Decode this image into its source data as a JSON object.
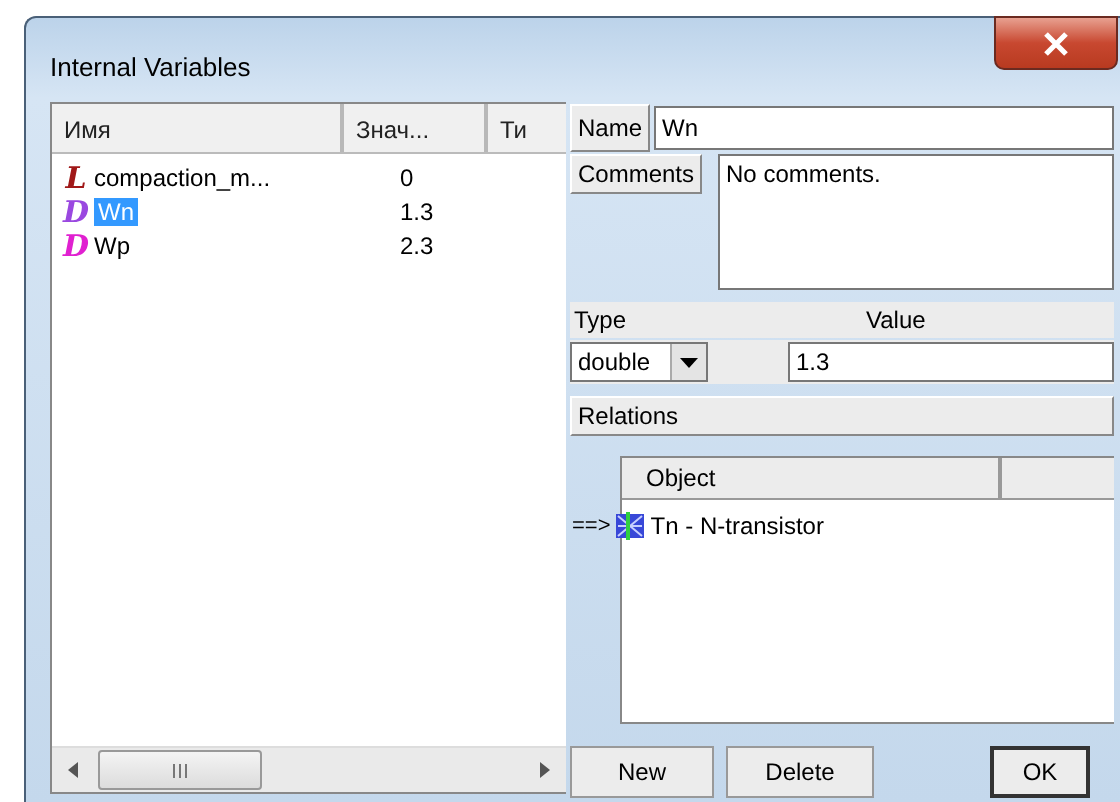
{
  "window": {
    "title": "Internal Variables"
  },
  "table": {
    "columns": [
      "Имя",
      "Знач...",
      "Ти"
    ],
    "rows": [
      {
        "badge": "L",
        "color": "#a01818",
        "name": "compaction_m...",
        "value": "0",
        "selected": false
      },
      {
        "badge": "D",
        "color": "#9a48e0",
        "name": "Wn",
        "value": "1.3",
        "selected": true
      },
      {
        "badge": "D",
        "color": "#e020d0",
        "name": "Wp",
        "value": "2.3",
        "selected": false
      }
    ]
  },
  "properties": {
    "name_label": "Name",
    "name_value": "Wn",
    "comments_label": "Comments",
    "comments_value": "No comments.",
    "type_label": "Type",
    "type_value": "double",
    "value_label": "Value",
    "value": "1.3"
  },
  "relations": {
    "label": "Relations",
    "columns": [
      "Object"
    ],
    "rows": [
      {
        "marker": "==>",
        "text": "Tn - N-transistor"
      }
    ]
  },
  "buttons": [
    "New",
    "Delete",
    "OK"
  ]
}
